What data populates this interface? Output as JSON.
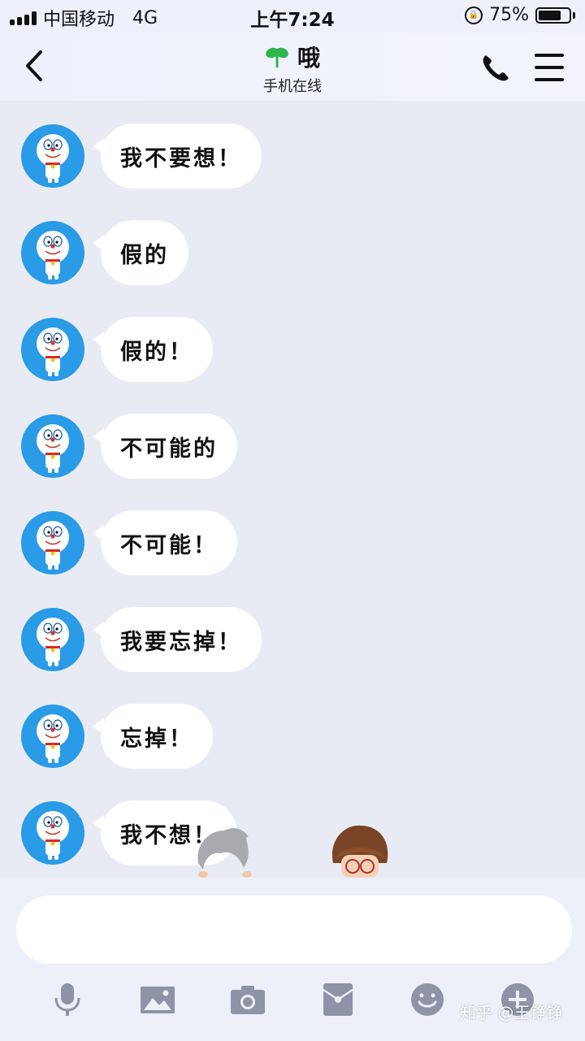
{
  "status_bar": {
    "carrier": "中国移动",
    "network": "4G",
    "time": "上午7:24",
    "battery_percent": "75%",
    "battery_level": 0.75
  },
  "header": {
    "title": "哦",
    "subtitle": "手机在线",
    "icons": [
      "chevron-left-icon",
      "leaf-icon",
      "phone-icon",
      "menu-icon"
    ]
  },
  "messages": [
    {
      "text": "我不要想！"
    },
    {
      "text": "假的"
    },
    {
      "text": "假的！"
    },
    {
      "text": "不可能的"
    },
    {
      "text": "不可能！"
    },
    {
      "text": "我要忘掉！"
    },
    {
      "text": "忘掉！"
    },
    {
      "text": "我不想！"
    }
  ],
  "input": {
    "value": "",
    "placeholder": ""
  },
  "toolbar": {
    "icons": [
      "microphone-icon",
      "image-icon",
      "camera-icon",
      "red-packet-icon",
      "emoji-icon",
      "plus-icon"
    ]
  },
  "watermark": "知乎 @王铮铮",
  "colors": {
    "chat_background": "#e9ebf4",
    "avatar_blue": "#2a9be6",
    "toolbar_icon": "#8e93a8",
    "title_leaf_green": "#2fb54a"
  }
}
